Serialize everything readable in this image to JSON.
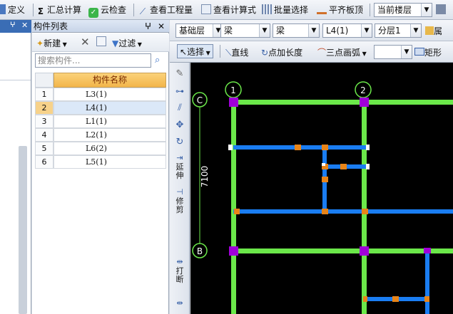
{
  "top_toolbar": {
    "define": "定义",
    "sum_calc": "汇总计算",
    "cloud_check": "云检查",
    "view_quantity": "查看工程量",
    "view_formula": "查看计算式",
    "batch_select": "批量选择",
    "align_slab": "平齐板顶",
    "floor_select": "当前楼层"
  },
  "component_panel": {
    "title": "构件列表",
    "new_label": "新建",
    "filter_label": "过滤",
    "search_placeholder": "搜索构件...",
    "column_header": "构件名称",
    "rows": [
      {
        "num": "1",
        "name": "L3(1)"
      },
      {
        "num": "2",
        "name": "L4(1)"
      },
      {
        "num": "3",
        "name": "L1(1)"
      },
      {
        "num": "4",
        "name": "L2(1)"
      },
      {
        "num": "5",
        "name": "L6(2)"
      },
      {
        "num": "6",
        "name": "L5(1)"
      }
    ],
    "selected_row": "2"
  },
  "cad_toolbar1": {
    "layer": "基础层",
    "type1": "梁",
    "type2": "梁",
    "component": "L4(1)",
    "sublayer": "分层1",
    "prop_short": "属"
  },
  "cad_toolbar2": {
    "select": "选择",
    "line": "直线",
    "point_length": "点加长度",
    "arc3": "三点画弧",
    "rect": "矩形"
  },
  "vertical_tools": {
    "extend": "延伸",
    "trim": "修剪",
    "break": "打断"
  },
  "drawing": {
    "axis_1": "1",
    "axis_2": "2",
    "axis_C": "C",
    "axis_B": "B",
    "dimension": "7100",
    "colors": {
      "grid_beam": "#6be84a",
      "beam": "#1a7df2",
      "column": "#a000d8",
      "joint": "#e88418"
    }
  }
}
